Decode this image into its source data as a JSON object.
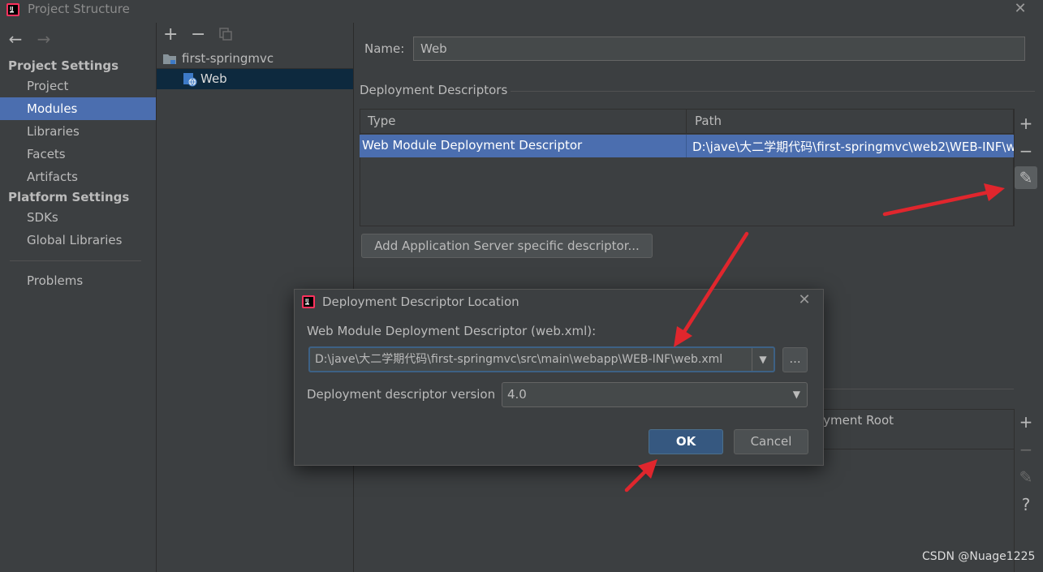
{
  "window": {
    "title": "Project Structure",
    "close_symbol": "✕"
  },
  "nav": {
    "back_symbol": "←",
    "forward_symbol": "→",
    "project_settings_header": "Project Settings",
    "platform_settings_header": "Platform Settings",
    "items": {
      "project": "Project",
      "modules": "Modules",
      "libraries": "Libraries",
      "facets": "Facets",
      "artifacts": "Artifacts",
      "sdks": "SDKs",
      "global_libraries": "Global Libraries",
      "problems": "Problems"
    }
  },
  "tree": {
    "add_symbol": "+",
    "remove_symbol": "−",
    "root": "first-springmvc",
    "child": "Web"
  },
  "module": {
    "name_label": "Name:",
    "name_value": "Web",
    "dd_section_title": "Deployment Descriptors",
    "table": {
      "col_type": "Type",
      "col_path": "Path",
      "row_type": "Web Module Deployment Descriptor",
      "row_path": "D:\\jave\\大二学期代码\\first-springmvc\\web2\\WEB-INF\\w"
    },
    "tools": {
      "add": "+",
      "remove": "−",
      "edit": "✎",
      "help": "?"
    },
    "add_server_button": "Add Application Server specific descriptor...",
    "lower_table_partial_header": "oyment Root"
  },
  "dialog": {
    "title": "Deployment Descriptor Location",
    "close_symbol": "✕",
    "path_label": "Web Module Deployment Descriptor (web.xml):",
    "path_value": "D:\\jave\\大二学期代码\\first-springmvc\\src\\main\\webapp\\WEB-INF\\web.xml",
    "dropdown_symbol": "▼",
    "browse_label": "...",
    "version_label": "Deployment descriptor version",
    "version_value": "4.0",
    "ok_label": "OK",
    "cancel_label": "Cancel"
  },
  "watermark": "CSDN @Nuage1225",
  "colors": {
    "background": "#3c3f41",
    "selection": "#4b6eaf",
    "tree_selection": "#0d293e",
    "ok_button": "#365880",
    "annotation_arrow": "#e0262d"
  }
}
